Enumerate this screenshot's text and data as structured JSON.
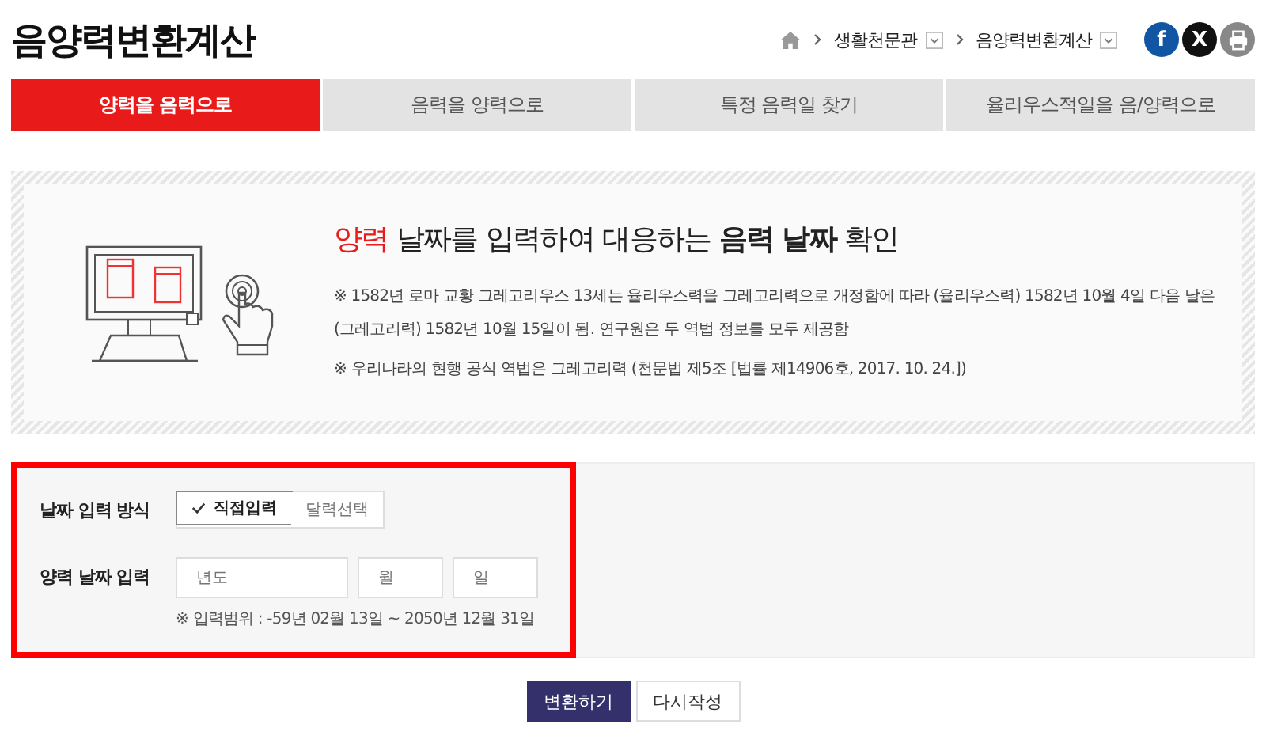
{
  "page_title": "음양력변환계산",
  "breadcrumb": [
    {
      "label": "생활천문관"
    },
    {
      "label": "음양력변환계산"
    }
  ],
  "share_buttons": [
    {
      "kind": "facebook",
      "label": "f"
    },
    {
      "kind": "x",
      "label": "X"
    },
    {
      "kind": "print"
    }
  ],
  "tabs": [
    {
      "label": "양력을 음력으로",
      "selected": true
    },
    {
      "label": "음력을 양력으로",
      "selected": false
    },
    {
      "label": "특정 음력일 찾기",
      "selected": false
    },
    {
      "label": "율리우스적일을 음/양력으로",
      "selected": false
    }
  ],
  "info": {
    "heading": [
      {
        "text": "양력",
        "kind": "accent"
      },
      {
        "text": "날짜를 입력하여 대응하는",
        "kind": "plain"
      },
      {
        "text": "음력 날짜",
        "kind": "strong"
      },
      {
        "text": "확인",
        "kind": "plain"
      }
    ],
    "notes": [
      "※ 1582년 로마 교황 그레고리우스 13세는 율리우스력을 그레고리력으로 개정함에 따라 (율리우스력) 1582년 10월 4일 다음 날은 (그레고리력) 1582년 10월 15일이 됨. 연구원은 두 역법 정보를 모두 제공함",
      "※ 우리나라의 현행 공식 역법은 그레고리력 (천문법 제5조 [법률 제14906호, 2017. 10. 24.])"
    ]
  },
  "form": {
    "highlighted": true,
    "method_label": "날짜 입력 방식",
    "methods": [
      {
        "label": "직접입력",
        "selected": true
      },
      {
        "label": "달력선택",
        "selected": false
      }
    ],
    "date_label": "양력 날짜 입력",
    "fields": [
      {
        "placeholder": "년도"
      },
      {
        "placeholder": "월"
      },
      {
        "placeholder": "일"
      }
    ],
    "range_note": "※ 입력범위 : -59년 02월 13일 ~ 2050년 12월 31일"
  },
  "buttons": [
    {
      "label": "변환하기",
      "kind": "primary"
    },
    {
      "label": "다시작성",
      "kind": "secondary"
    }
  ]
}
